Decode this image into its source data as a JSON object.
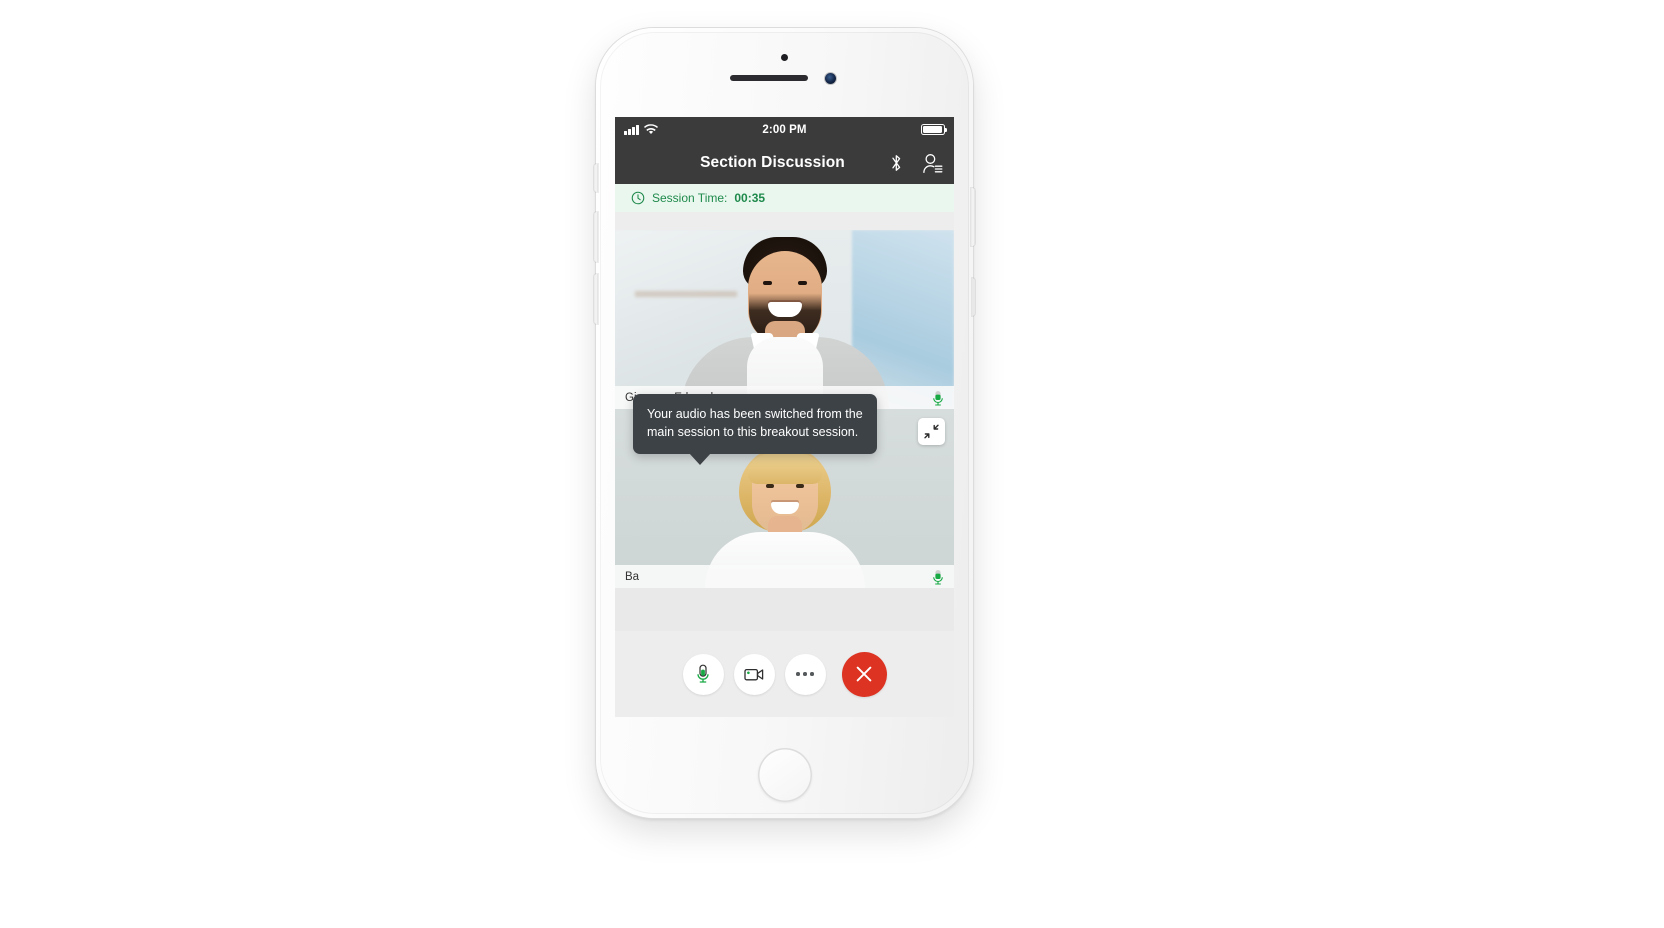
{
  "device": {
    "kind": "smartphone",
    "frame_color": "#f5f5f5"
  },
  "status_bar": {
    "signal_icon": "cellular-signal-icon",
    "wifi_icon": "wifi-icon",
    "time": "2:00 PM",
    "battery_icon": "battery-full-icon"
  },
  "nav_bar": {
    "title": "Section Discussion",
    "bluetooth_icon": "bluetooth-icon",
    "participants_icon": "participants-list-icon",
    "background": "#3b3b3b"
  },
  "session_banner": {
    "clock_icon": "clock-icon",
    "label": "Session Time:",
    "value": "00:35",
    "text_color": "#1f8a4c",
    "background": "#eaf7ee"
  },
  "video_tiles": [
    {
      "name": "Giacomo Edwards",
      "mic_icon": "microphone-active-icon",
      "mic_state": "active",
      "subject": "man-smiling-in-office"
    },
    {
      "name": "Ba",
      "mic_icon": "microphone-active-icon",
      "mic_state": "active",
      "subject": "woman-smiling-blonde"
    }
  ],
  "collapse_button": {
    "icon": "collapse-inward-icon",
    "label": ""
  },
  "tooltip": {
    "message": "Your audio has been switched from the main session to this breakout session.",
    "background": "#3d4246"
  },
  "controls": [
    {
      "name": "microphone-button",
      "icon": "microphone-level-icon",
      "style": "light"
    },
    {
      "name": "video-camera-button",
      "icon": "video-camera-icon",
      "style": "light"
    },
    {
      "name": "more-options-button",
      "icon": "ellipsis-icon",
      "style": "light"
    },
    {
      "name": "leave-session-button",
      "icon": "close-x-icon",
      "style": "danger",
      "color": "#dd3322"
    }
  ]
}
